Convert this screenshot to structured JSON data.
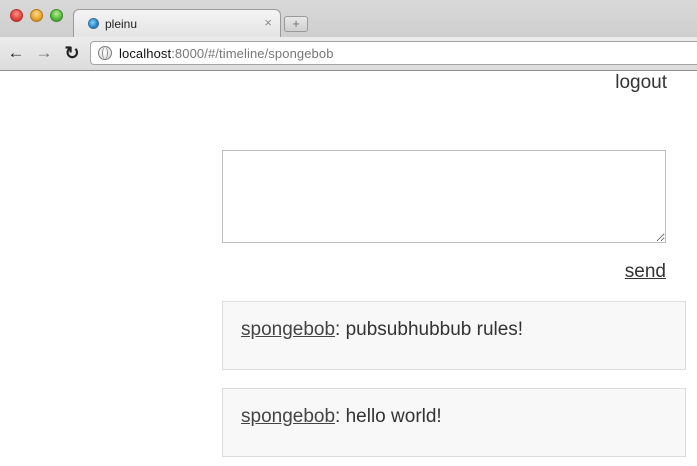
{
  "browser": {
    "tab_title": "pleinu",
    "tab_close_label": "×",
    "new_tab_label": "+",
    "nav": {
      "back_label": "←",
      "forward_label": "→",
      "reload_label": "↻"
    },
    "url": {
      "host": "localhost",
      "rest": ":8000/#/timeline/spongebob"
    },
    "icons": {
      "favicon": "globe-favicon-icon",
      "omnibox": "globe-icon"
    }
  },
  "header": {
    "logout_label": "logout"
  },
  "compose": {
    "value": "",
    "send_label": "send"
  },
  "timeline": {
    "posts": [
      {
        "author": "spongebob",
        "separator": ": ",
        "text": "pubsubhubbub rules!"
      },
      {
        "author": "spongebob",
        "separator": ": ",
        "text": "hello world!"
      }
    ]
  }
}
